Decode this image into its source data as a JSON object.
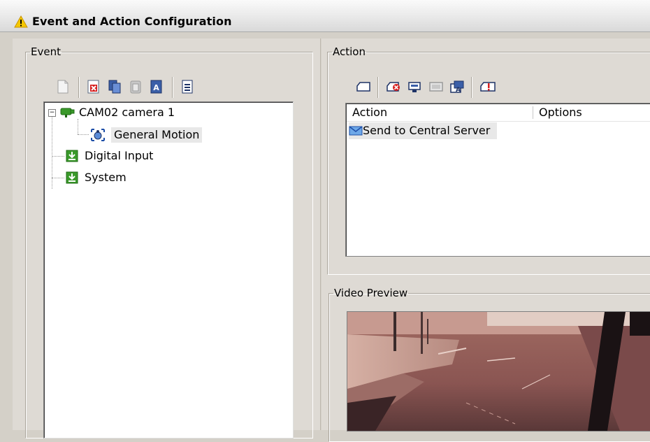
{
  "window": {
    "title": "Event and Action Configuration",
    "title_icon": "warning-icon"
  },
  "event_panel": {
    "legend": "Event",
    "toolbar": [
      {
        "name": "new-event-icon"
      },
      {
        "name": "delete-event-icon"
      },
      {
        "name": "copy-event-icon"
      },
      {
        "name": "paste-event-icon"
      },
      {
        "name": "rename-event-icon"
      },
      {
        "name": "properties-event-icon"
      }
    ],
    "tree": {
      "camera": {
        "label": "CAM02 camera 1",
        "icon": "camera-icon",
        "expanded": true
      },
      "motion": {
        "label": "General Motion",
        "icon": "motion-icon",
        "selected": true
      },
      "digital_input": {
        "label": "Digital Input",
        "icon": "digital-input-icon"
      },
      "system": {
        "label": "System",
        "icon": "system-icon"
      }
    }
  },
  "action_panel": {
    "legend": "Action",
    "toolbar": [
      {
        "name": "add-action-icon"
      },
      {
        "name": "delete-action-icon"
      },
      {
        "name": "move-action-icon"
      },
      {
        "name": "disabled-action-icon"
      },
      {
        "name": "edit-action-icon"
      },
      {
        "name": "test-action-icon"
      }
    ],
    "columns": [
      "Action",
      "Options"
    ],
    "rows": [
      {
        "action": "Send to Central Server",
        "options": "",
        "icon": "email-icon"
      }
    ]
  },
  "video_panel": {
    "legend": "Video Preview"
  },
  "colors": {
    "background": "#d4d0c8",
    "selection": "#e8e8e8",
    "tree_icon_green": "#3a9a2a"
  }
}
